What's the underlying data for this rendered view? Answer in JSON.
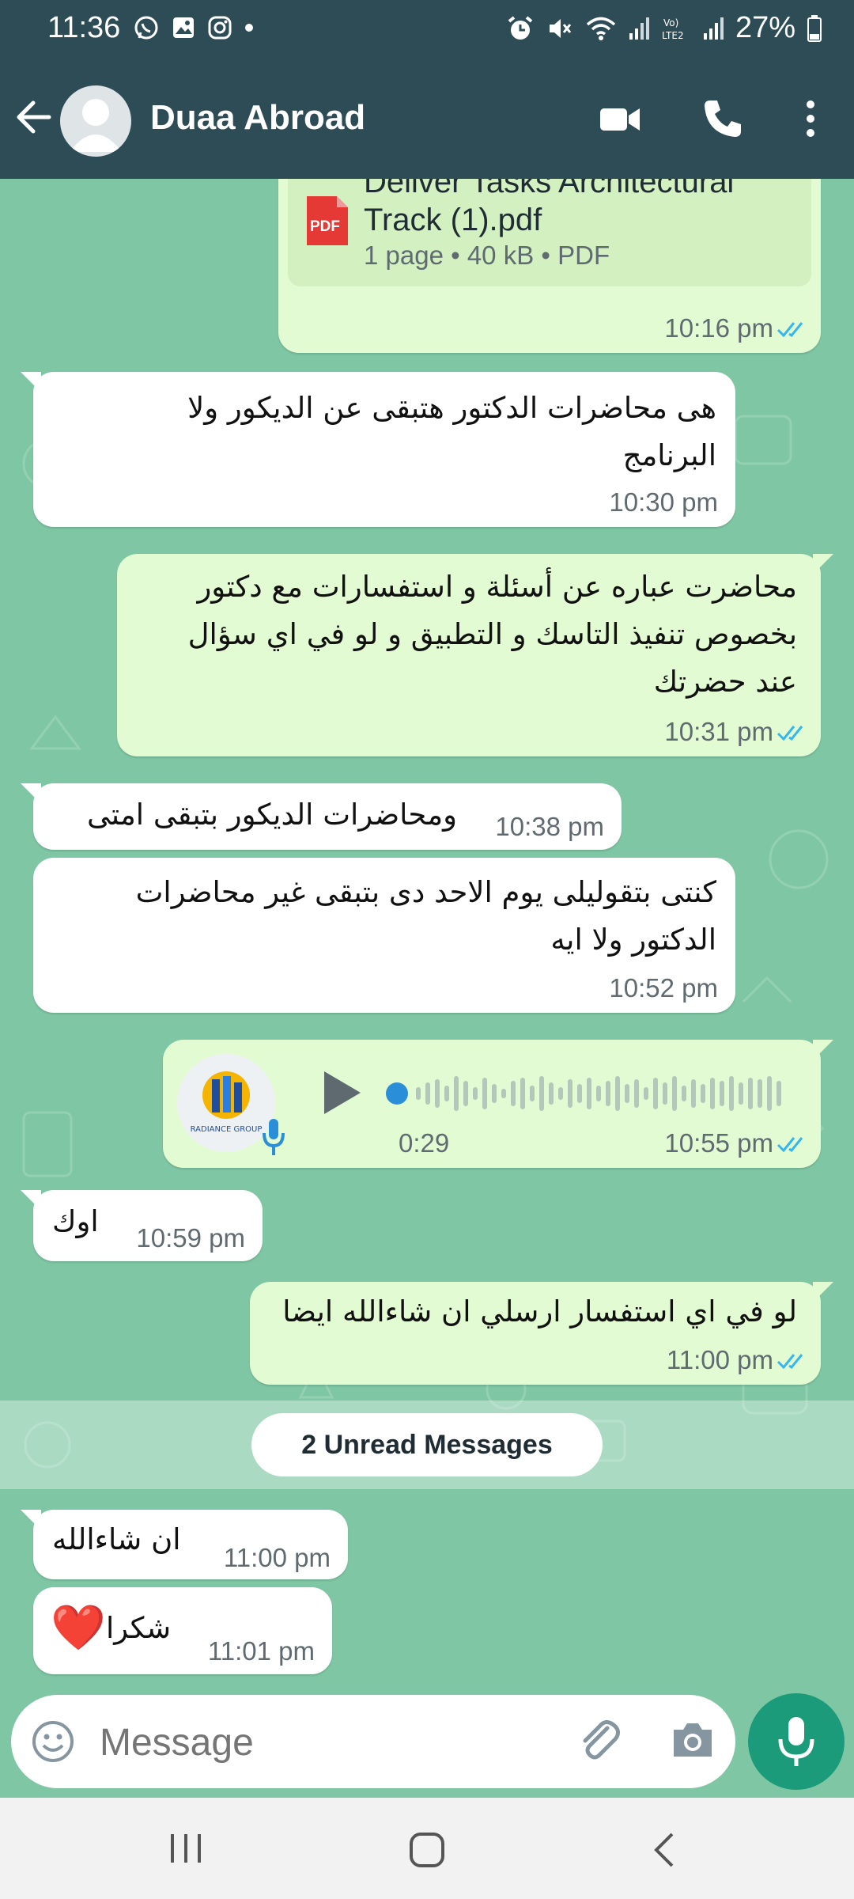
{
  "status_bar": {
    "time": "11:36",
    "battery": "27%"
  },
  "header": {
    "contact_name": "Duaa Abroad",
    "icons": [
      "back-arrow-icon",
      "video-call-icon",
      "phone-call-icon",
      "more-options-icon"
    ]
  },
  "messages": [
    {
      "type": "document",
      "direction": "out",
      "file_name_line1": "Deliver Tasks Architectural",
      "file_name_line2": "Track (1).pdf",
      "file_meta": "1 page • 40 kB • PDF",
      "file_badge": "PDF",
      "time": "10:16 pm",
      "read": true
    },
    {
      "type": "text",
      "direction": "in",
      "lines": [
        "هى محاضرات الدكتور هتبقى عن الديكور ولا",
        "البرنامج"
      ],
      "time": "10:30 pm"
    },
    {
      "type": "text",
      "direction": "out",
      "lines": [
        "محاضرت عباره عن أسئلة و استفسارات مع دكتور",
        "بخصوص تنفيذ التاسك و التطبيق و لو في اي سؤال",
        "عند حضرتك"
      ],
      "time": "10:31 pm",
      "read": true
    },
    {
      "type": "text",
      "direction": "in",
      "lines": [
        "ومحاضرات الديكور بتبقى امتى"
      ],
      "time": "10:38 pm"
    },
    {
      "type": "text",
      "direction": "in",
      "lines": [
        "كنتى بتقوليلى يوم الاحد دى بتبقى غير محاضرات",
        "الدكتور ولا ايه"
      ],
      "time": "10:52 pm"
    },
    {
      "type": "voice",
      "direction": "out",
      "duration": "0:29",
      "avatar_brand": "RADIANCE GROUP",
      "time": "10:55 pm",
      "read": true
    },
    {
      "type": "text",
      "direction": "in",
      "lines": [
        "اوك"
      ],
      "time": "10:59 pm"
    },
    {
      "type": "text",
      "direction": "out",
      "lines": [
        "لو في اي استفسار ارسلي ان شاءالله ايضا"
      ],
      "time": "11:00 pm",
      "read": true
    },
    {
      "type": "text",
      "direction": "in",
      "lines": [
        "ان شاءالله"
      ],
      "time": "11:00 pm"
    },
    {
      "type": "text",
      "direction": "in",
      "lines": [
        "شكرا"
      ],
      "emoji": "❤️",
      "time": "11:01 pm"
    }
  ],
  "unread_banner": "2 Unread Messages",
  "input": {
    "placeholder": "Message"
  },
  "colors": {
    "header": "#2e4c56",
    "chat_bg": "#7fc7a4",
    "outgoing": "#e3fbd3",
    "incoming": "#ffffff",
    "fab": "#1c9b7b",
    "tick": "#34b7f1"
  }
}
